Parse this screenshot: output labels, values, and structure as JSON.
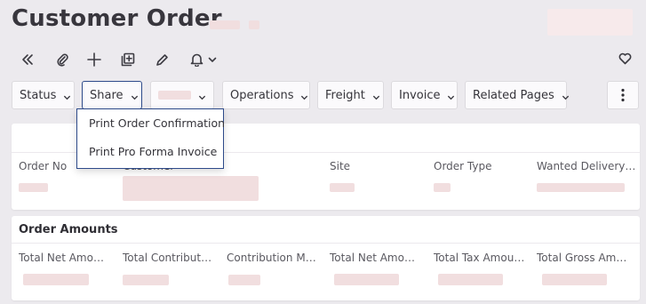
{
  "page": {
    "title": "Customer Order"
  },
  "toolbar": {
    "icons": [
      "double-chevron-left-icon",
      "paperclip-icon",
      "plus-icon",
      "duplicate-icon",
      "pencil-icon",
      "bell-icon",
      "chevron-down-icon",
      "heart-icon"
    ]
  },
  "action_bar": {
    "status_label": "Status",
    "share_label": "Share",
    "operations_label": "Operations",
    "freight_label": "Freight",
    "invoice_label": "Invoice",
    "related_pages_label": "Related Pages"
  },
  "share_menu": {
    "items": [
      "Print Order Confirmation",
      "Print Pro Forma Invoice"
    ]
  },
  "header_card": {
    "columns": [
      "Order No",
      "Customer",
      "Site",
      "Order Type",
      "Wanted Delivery ..."
    ]
  },
  "order_amounts": {
    "title": "Order Amounts",
    "columns": [
      "Total Net Amoun...",
      "Total Contributio...",
      "Contribution Mar...",
      "Total Net Amoun...",
      "Total Tax Amoun...",
      "Total Gross Amo..."
    ]
  },
  "colors": {
    "accent": "#2d4a8a",
    "placeholder": "#f1dedf",
    "background": "#eceaee"
  }
}
